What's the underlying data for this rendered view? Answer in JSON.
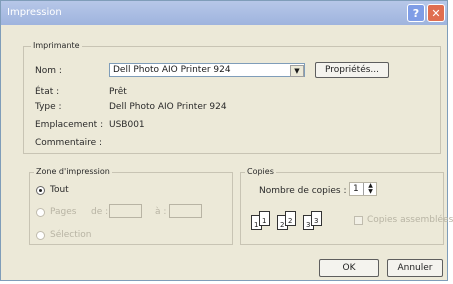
{
  "window": {
    "title": "Impression",
    "help_label": "?",
    "close_label": "✕"
  },
  "printer": {
    "legend": "Imprimante",
    "name_label": "Nom :",
    "name_value": "Dell Photo AIO Printer 924",
    "properties_button": "Propriétés...",
    "status_label": "État :",
    "status_value": "Prêt",
    "type_label": "Type :",
    "type_value": "Dell Photo AIO Printer 924",
    "location_label": "Emplacement :",
    "location_value": "USB001",
    "comment_label": "Commentaire :"
  },
  "range": {
    "legend": "Zone d'impression",
    "all_label": "Tout",
    "pages_label": "Pages",
    "from_label": "de :",
    "to_label": "à :",
    "selection_label": "Sélection",
    "selected": "Tout"
  },
  "copies": {
    "legend": "Copies",
    "count_label": "Nombre de copies :",
    "count_value": "1",
    "collate_label": "Copies assemblées",
    "collate_checked": false,
    "page_numbers": [
      "1",
      "1",
      "2",
      "2",
      "3",
      "3"
    ]
  },
  "buttons": {
    "ok": "OK",
    "cancel": "Annuler"
  }
}
